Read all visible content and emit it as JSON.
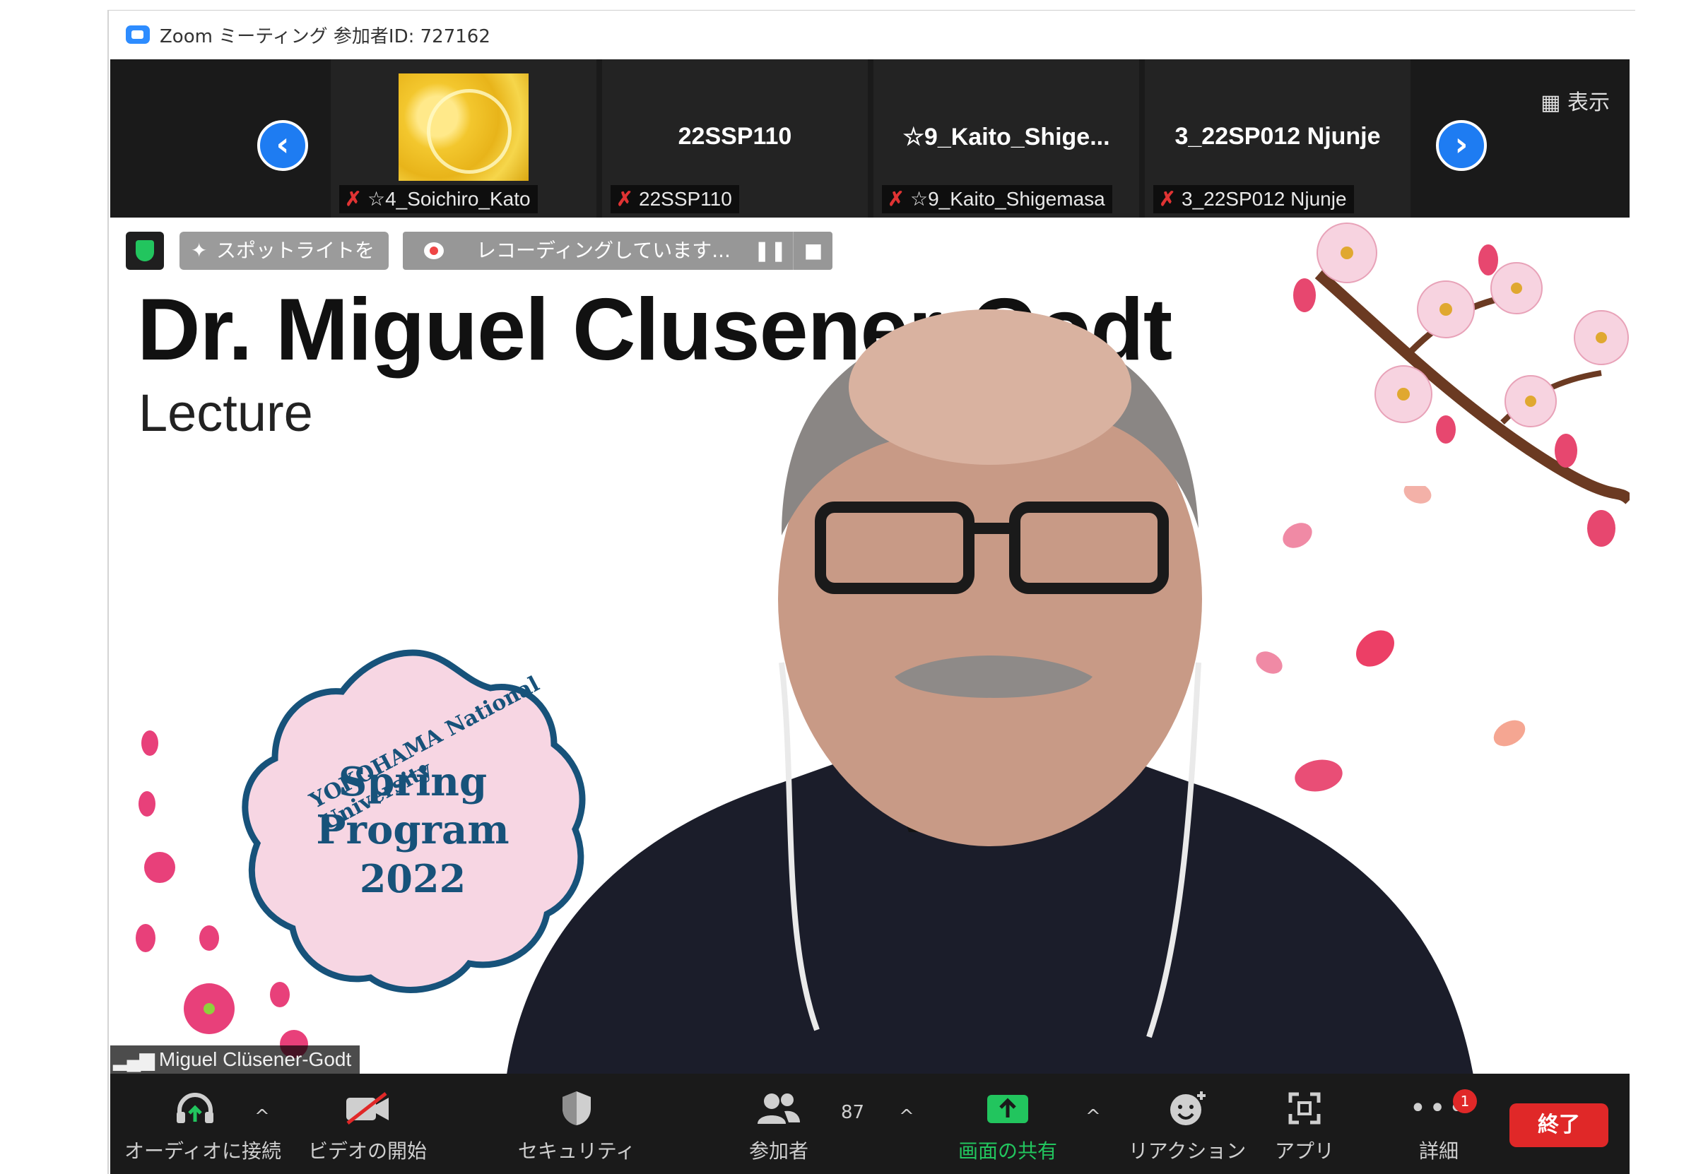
{
  "window": {
    "title": "Zoom ミーティング 参加者ID: 727162"
  },
  "gallery": {
    "view_label": "表示",
    "tiles": [
      {
        "display": "",
        "name": "☆4_Soichiro_Kato",
        "has_image": true
      },
      {
        "display": "22SSP110",
        "name": "22SSP110"
      },
      {
        "display": "☆9_Kaito_Shige...",
        "name": "☆9_Kaito_Shigemasa"
      },
      {
        "display": "3_22SP012 Njunje",
        "name": "3_22SP012 Njunje"
      }
    ]
  },
  "controls": {
    "spotlight": "スポットライトを削除",
    "recording": "レコーディングしています...",
    "pause": "❚❚",
    "stop": "■"
  },
  "slide": {
    "title": "Dr. Miguel Clusener-Godt",
    "subtitle": "Lecture",
    "badge_arc": "YOKOHAMA National University",
    "badge_line1": "Spring",
    "badge_line2": "Program",
    "badge_line3": "2022"
  },
  "speaker": {
    "name": "Miguel Clüsener-Godt"
  },
  "toolbar": {
    "audio": "オーディオに接続",
    "video": "ビデオの開始",
    "security": "セキュリティ",
    "participants": "参加者",
    "participants_count": "87",
    "share": "画面の共有",
    "reactions": "リアクション",
    "apps": "アプリ",
    "more": "詳細",
    "more_badge": "1",
    "end": "終了"
  },
  "colors": {
    "accent": "#1e7cf2",
    "share_green": "#22c55e",
    "end_red": "#e02828",
    "badge_blue": "#17527a"
  }
}
